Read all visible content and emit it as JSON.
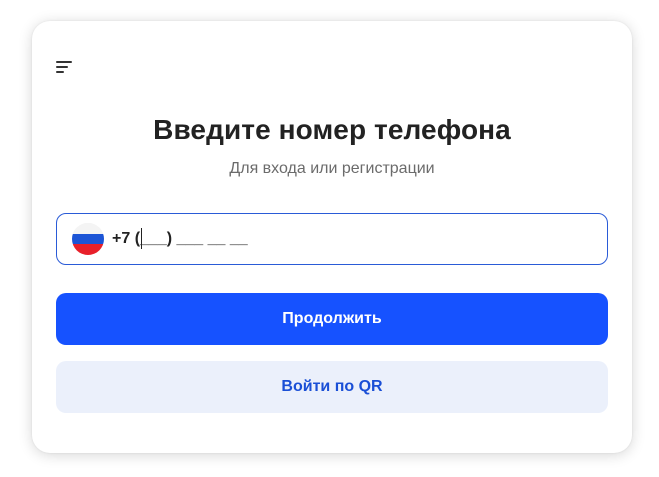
{
  "login": {
    "title": "Введите номер телефона",
    "subtitle": "Для входа или регистрации",
    "phone": {
      "country": "Russia",
      "country_flag_icon": "russia-flag-icon",
      "value": "+7 (___) ___ __ __"
    },
    "continue_label": "Продолжить",
    "qr_label": "Войти по QR"
  },
  "icons": {
    "menu": "menu-icon"
  },
  "colors": {
    "primary": "#1652ff",
    "secondary_bg": "#ebf0fb",
    "secondary_text": "#1a4fd6",
    "focus_border": "#2a5bd7"
  }
}
